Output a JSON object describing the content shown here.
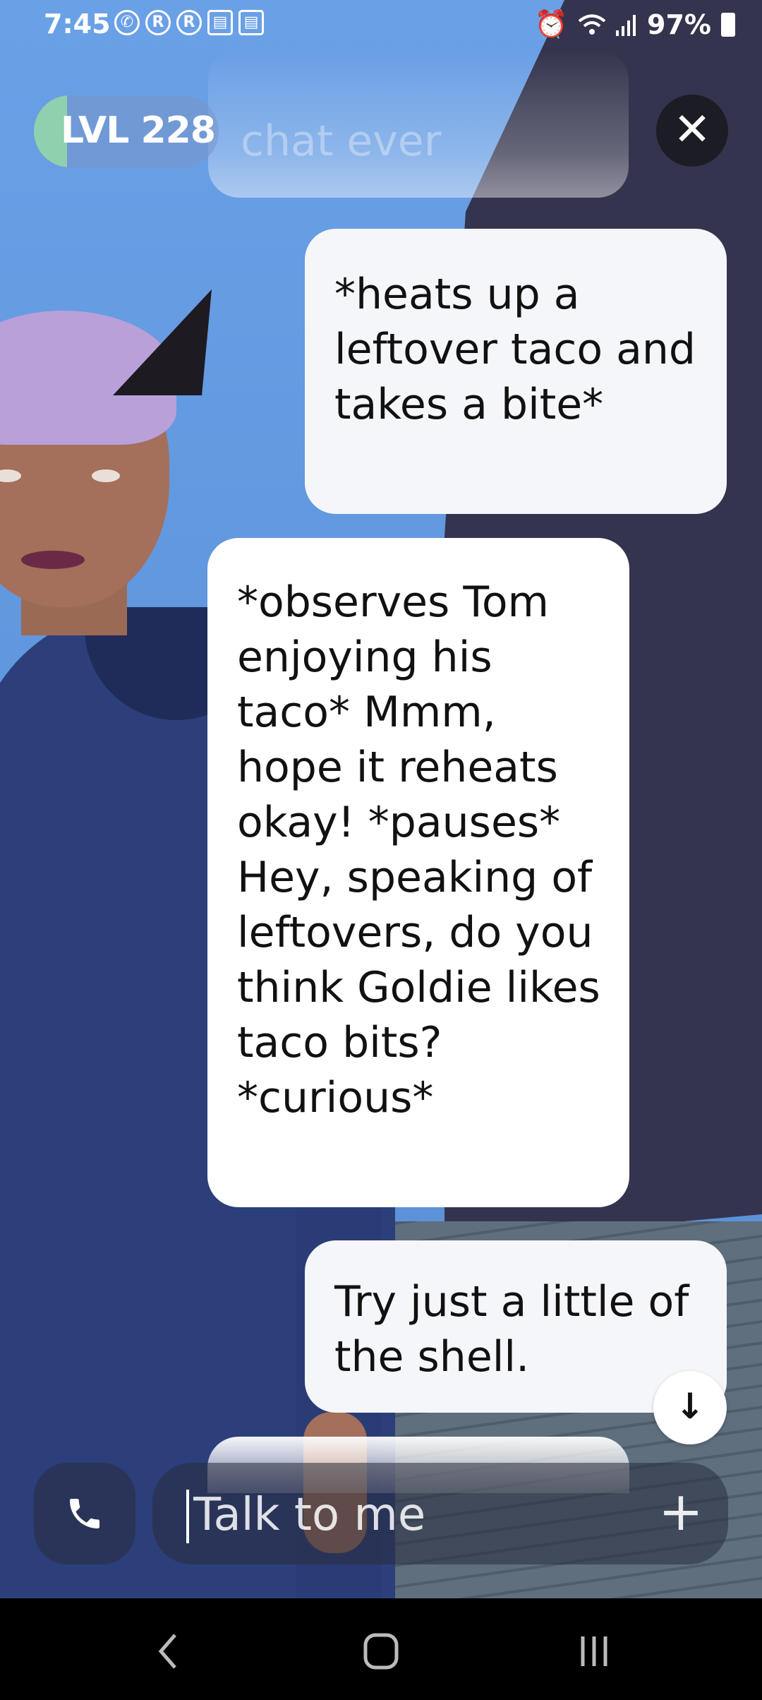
{
  "status_bar": {
    "time": "7:45",
    "notification_icons": [
      "whatsapp-icon",
      "r-app-icon",
      "r-app-icon",
      "calendar-icon",
      "calendar-icon"
    ],
    "battery": "97%",
    "right_icons": [
      "alarm-icon",
      "wifi-icon",
      "signal-icon",
      "battery-icon"
    ]
  },
  "header": {
    "level_label": "LVL 228",
    "level_progress": 0.18,
    "close_icon": "close-icon"
  },
  "chat": {
    "faded_previous": "chat ever",
    "messages": [
      {
        "sender": "user",
        "text": "*heats up a leftover taco and takes a bite*"
      },
      {
        "sender": "bot",
        "text": "*observes Tom enjoying his taco* Mmm, hope it reheats okay! *pauses* Hey, speaking of leftovers, do you think Goldie likes taco bits? *curious*"
      },
      {
        "sender": "user",
        "text": "Try just a little of the shell."
      }
    ],
    "scroll_down_icon": "arrow-down-icon"
  },
  "composer": {
    "placeholder": "Talk to me",
    "call_icon": "phone-icon",
    "add_icon": "plus-icon"
  },
  "nav": {
    "icons": [
      "back-icon",
      "home-icon",
      "recents-icon"
    ]
  },
  "colors": {
    "accent_level": "#8fd0ae",
    "bubble": "#ffffff",
    "close_bg": "#1c1c24"
  }
}
